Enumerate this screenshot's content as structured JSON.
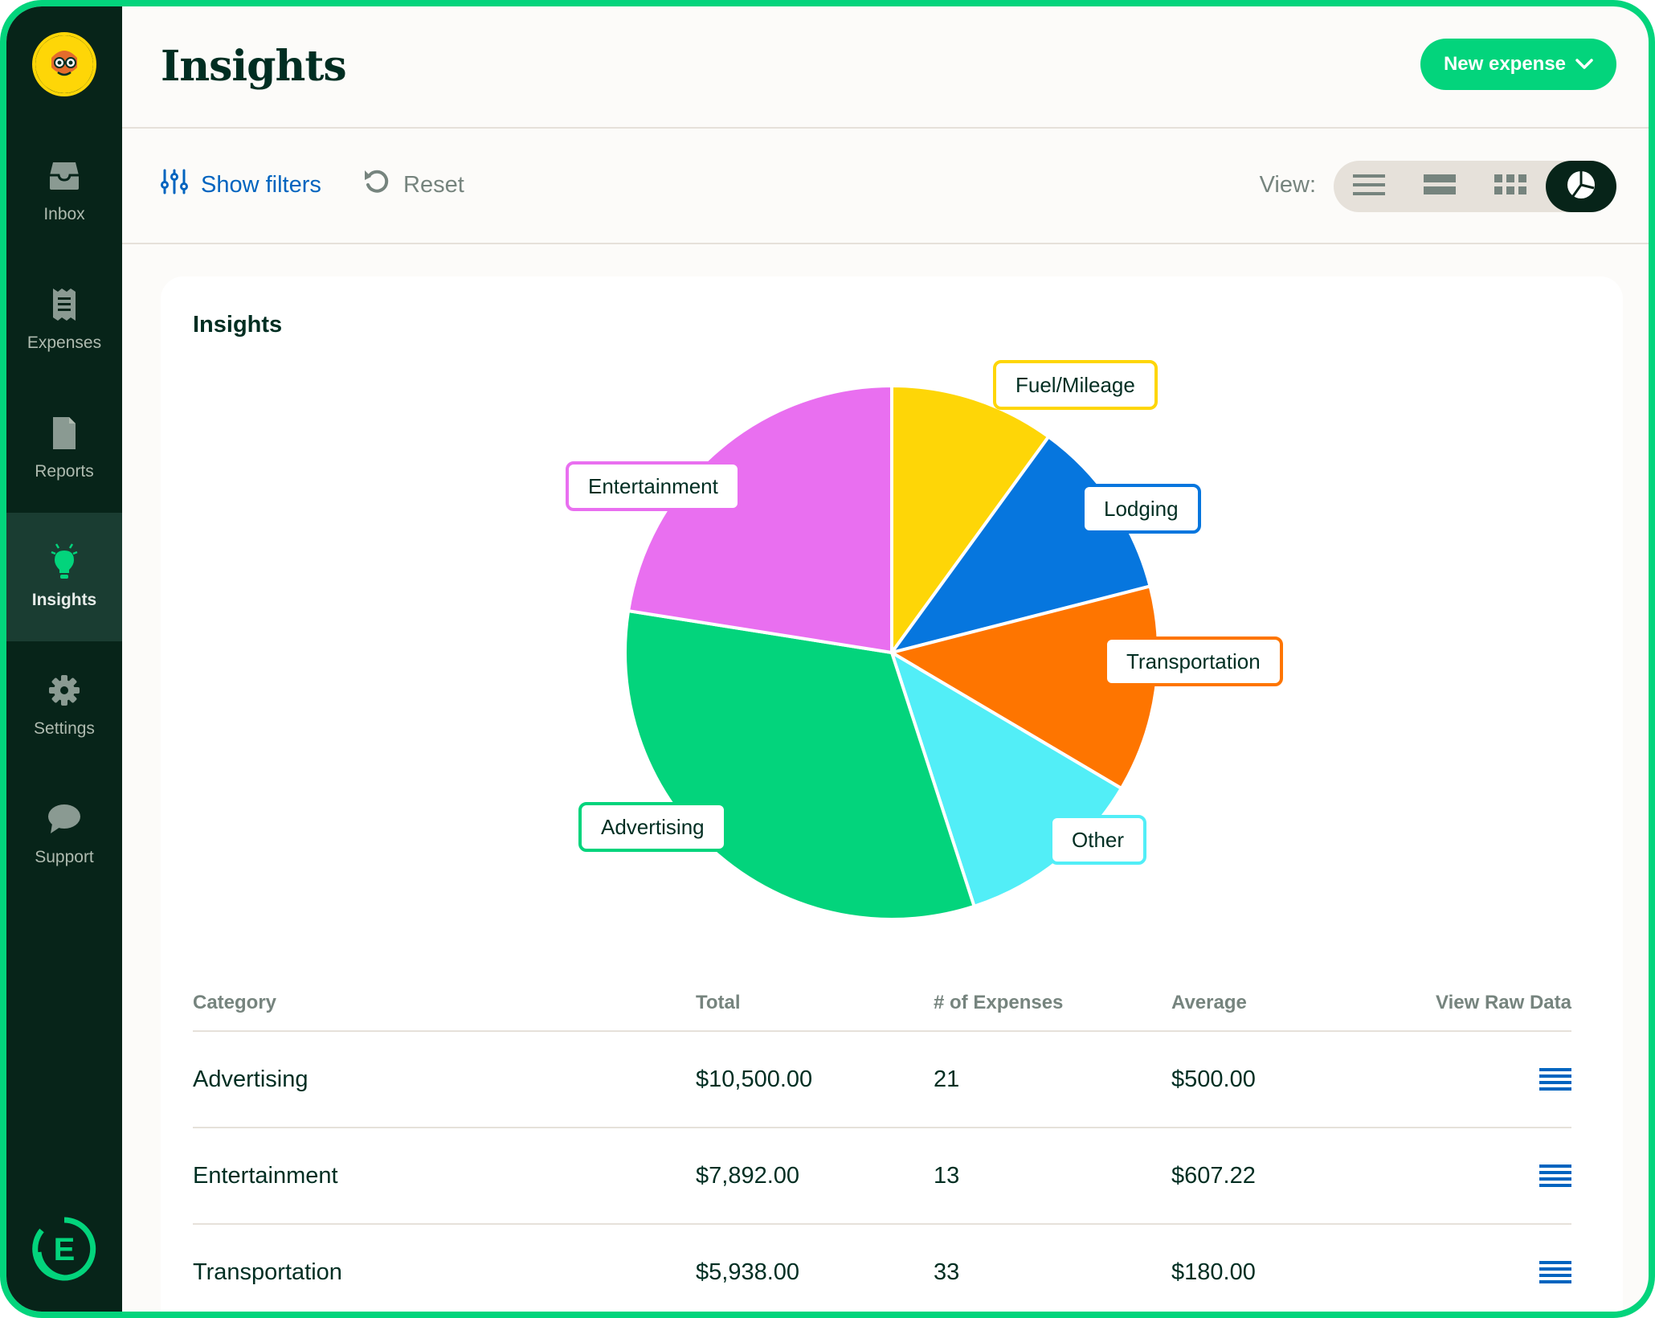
{
  "sidebar": {
    "items": [
      {
        "label": "Inbox",
        "icon": "inbox-icon"
      },
      {
        "label": "Expenses",
        "icon": "receipt-icon"
      },
      {
        "label": "Reports",
        "icon": "document-icon"
      },
      {
        "label": "Insights",
        "icon": "lightbulb-icon",
        "active": true
      },
      {
        "label": "Settings",
        "icon": "gear-icon"
      },
      {
        "label": "Support",
        "icon": "chat-bubble-icon"
      }
    ],
    "logo": "E"
  },
  "header": {
    "title": "Insights",
    "new_expense_label": "New expense"
  },
  "toolbar": {
    "show_filters_label": "Show filters",
    "reset_label": "Reset",
    "view_label": "View:",
    "views": [
      "list-view-icon",
      "compact-list-view-icon",
      "grid-view-icon",
      "pie-chart-view-icon"
    ],
    "active_view": "pie-chart-view-icon"
  },
  "card": {
    "title": "Insights"
  },
  "chart_data": {
    "type": "pie",
    "categories": [
      "Fuel/Mileage",
      "Lodging",
      "Transportation",
      "Other",
      "Advertising",
      "Entertainment"
    ],
    "values": [
      10.0,
      11.0,
      12.5,
      11.5,
      32.5,
      22.5
    ],
    "colors": [
      "#fed607",
      "#0676de",
      "#fe7500",
      "#52eef7",
      "#03d47c",
      "#e96ff0"
    ],
    "title": ""
  },
  "table": {
    "headers": [
      "Category",
      "Total",
      "# of Expenses",
      "Average",
      "View Raw Data"
    ],
    "rows": [
      [
        "Advertising",
        "$10,500.00",
        "21",
        "$500.00"
      ],
      [
        "Entertainment",
        "$7,892.00",
        "13",
        "$607.22"
      ],
      [
        "Transportation",
        "$5,938.00",
        "33",
        "$180.00"
      ]
    ]
  },
  "colors": {
    "accent": "#03d47c",
    "sidebar_bg": "#072419",
    "link": "#0164bf"
  }
}
